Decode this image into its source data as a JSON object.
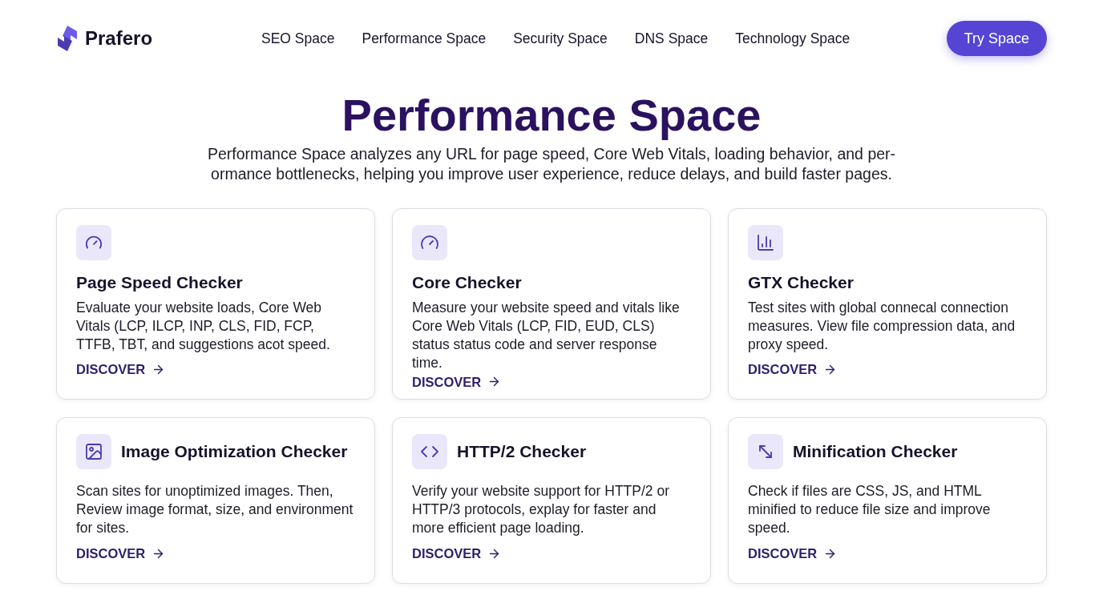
{
  "brand": {
    "name": "Prafero"
  },
  "nav": [
    {
      "label": "SEO Space",
      "selected": false
    },
    {
      "label": "Performance Space",
      "selected": false
    },
    {
      "label": "Security Space",
      "selected": false
    },
    {
      "label": "DNS Space",
      "selected": false
    },
    {
      "label": "Technology Space",
      "selected": false
    }
  ],
  "cta": {
    "label": "Try Space"
  },
  "hero": {
    "title": "Performance Space",
    "subtitle": "Performance Space analyzes any URL for page speed, Core Web Vitals, loading behavior, and per-ormance bottlenecks, helping you improve user experience, reduce delays, and build faster pages."
  },
  "cards": [
    {
      "kind": "stacked",
      "title": "Page Speed Checker",
      "description": "Evaluate your website loads, Core Web Vitals (LCP, ILCP, INP, CLS, FID, FCP, TTFB, TBT, and suggestions acot speed.",
      "link": "DISCOVER"
    },
    {
      "kind": "stacked",
      "title": "Core Checker",
      "description": "Measure your website speed and vitals like Core Web Vitals (LCP, FID, EUD, CLS) status status code and server response time.",
      "link": "DISCOVER"
    },
    {
      "kind": "stacked",
      "title": "GTX Checker",
      "description": "Test sites with global connecal connection measures. View file compression data, and proxy speed.",
      "link": "DISCOVER"
    },
    {
      "kind": "inline",
      "title": "Image Optimization Checker",
      "description": "Scan sites for unoptimized images. Then, Review image format, size, and environment for sites.",
      "link": "DISCOVER"
    },
    {
      "kind": "inline",
      "title": "HTTP/2 Checker",
      "description": "Verify your website support for HTTP/2 or HTTP/3 protocols, explay for faster and more efficient page loading.",
      "link": "DISCOVER"
    },
    {
      "kind": "inline",
      "title": "Minification Checker",
      "description": "Check if files are CSS, JS, and HTML minified to reduce file size and improve speed.",
      "link": "DISCOVER"
    }
  ]
}
